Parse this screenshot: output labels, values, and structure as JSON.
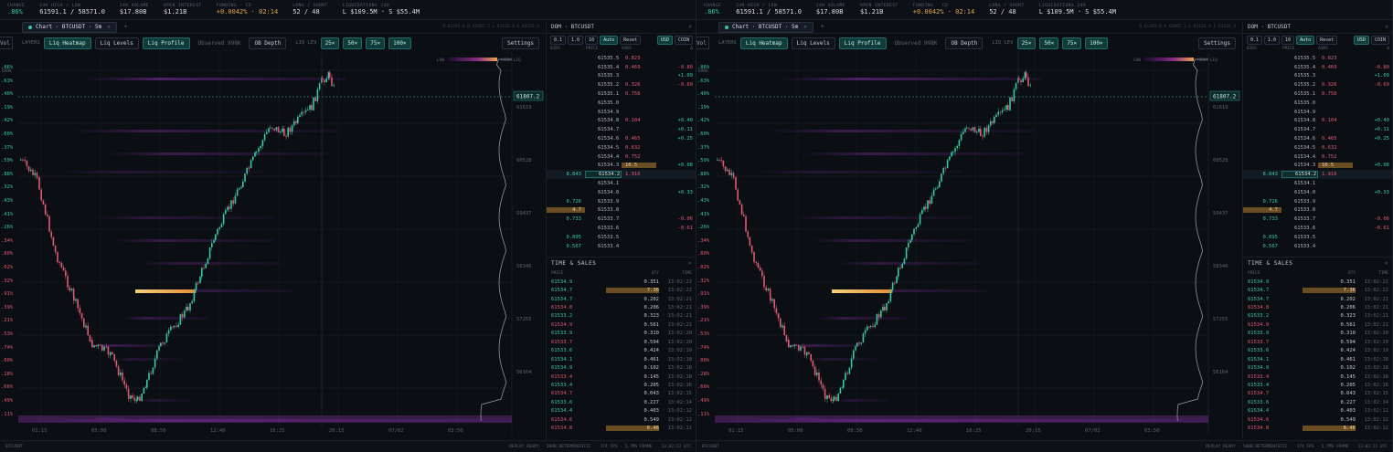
{
  "stats": [
    {
      "label": "CHANGE",
      "value": ".86%",
      "tone": "green"
    },
    {
      "label": "24H HIGH / LOW",
      "value": "61591.1 / 58571.0",
      "tone": ""
    },
    {
      "label": "24H VOLUME",
      "value": "$17.80B",
      "tone": ""
    },
    {
      "label": "OPEN INTEREST",
      "value": "$1.21B",
      "tone": ""
    },
    {
      "label": "FUNDING · CD",
      "value": "+0.0042% · 02:14",
      "tone": "amber"
    },
    {
      "label": "LONG / SHORT",
      "value": "52 / 48",
      "tone": ""
    },
    {
      "label": "LIQUIDATIONS 24H",
      "value": "L $109.5M · S $55.4M",
      "tone": ""
    }
  ],
  "tab": {
    "label": "Chart · BTCUSDT · 5m",
    "close": "×",
    "plus": "+",
    "info": "O 61395.0   H 61807.2   L 61135.4   C 61135.4"
  },
  "controls": {
    "vol": "Vol",
    "layers_label": "LAYERS",
    "liq_heatmap": "Liq Heatmap",
    "liq_levels": "Liq Levels",
    "liq_profile": "Liq Profile",
    "observed": "Observed 998K",
    "ob_depth": "OB Depth",
    "liq_lev_label": "LIQ LEV",
    "lev": [
      "25×",
      "50×",
      "75×",
      "100×"
    ],
    "settings": "Settings"
  },
  "legend": {
    "dark": "DARK",
    "low": "LOW",
    "high": "HIGH LIQ"
  },
  "price_tag": "61807.2",
  "yleft": [
    {
      "t": ".86%",
      "c": "gr"
    },
    {
      "t": ".63%",
      "c": "gr"
    },
    {
      "t": ".40%",
      "c": "gr"
    },
    {
      "t": ".19%",
      "c": "gr"
    },
    {
      "t": ".42%",
      "c": "gr"
    },
    {
      "t": ".60%",
      "c": "gr"
    },
    {
      "t": ".37%",
      "c": "gr"
    },
    {
      "t": ".59%",
      "c": "gr"
    },
    {
      "t": ".88%",
      "c": "gr"
    },
    {
      "t": ".32%",
      "c": "gr"
    },
    {
      "t": ".43%",
      "c": "gr"
    },
    {
      "t": ".41%",
      "c": "gr"
    },
    {
      "t": ".26%",
      "c": "gr"
    },
    {
      "t": ".34%",
      "c": "rd"
    },
    {
      "t": ".80%",
      "c": "rd"
    },
    {
      "t": ".02%",
      "c": "rd"
    },
    {
      "t": ".32%",
      "c": "rd"
    },
    {
      "t": ".91%",
      "c": "rd"
    },
    {
      "t": ".39%",
      "c": "rd"
    },
    {
      "t": ".21%",
      "c": "rd"
    },
    {
      "t": ".53%",
      "c": "rd"
    },
    {
      "t": ".74%",
      "c": "rd"
    },
    {
      "t": ".00%",
      "c": "rd"
    },
    {
      "t": ".28%",
      "c": "rd"
    },
    {
      "t": ".66%",
      "c": "rd"
    },
    {
      "t": ".49%",
      "c": "rd"
    },
    {
      "t": ".11%",
      "c": "rd"
    }
  ],
  "yright": [
    "61619",
    "60528",
    "59437",
    "58346",
    "57255",
    "56164"
  ],
  "xaxis": [
    "01:15",
    "05:00",
    "08:50",
    "12:40",
    "16:25",
    "20:15",
    "07/02",
    "03:50"
  ],
  "bottom": {
    "left": "BTCUSDT",
    "replay": "REPLAY READY · 500B DETERMINISTIC",
    "fps": "174 FPS · 5.7MS FRAME",
    "time": "13:02:22 UTC"
  },
  "dom": {
    "title": "DOM · BTCUSDT",
    "close": "×",
    "steps": [
      "0.1",
      "1.0",
      "10",
      "Auto",
      "Reset"
    ],
    "units": [
      "USD",
      "COIN"
    ],
    "cols": [
      "BIDS",
      "PRICE",
      "ASKS",
      "Δ"
    ],
    "rows": [
      {
        "bid": "",
        "price": "61535.5",
        "ask": "0.823",
        "d": "",
        "dc": ""
      },
      {
        "bid": "",
        "price": "61535.4",
        "ask": "0.469",
        "d": "-0.80",
        "dc": "rd"
      },
      {
        "bid": "",
        "price": "61535.3",
        "ask": "",
        "d": "+1.09",
        "dc": "gr"
      },
      {
        "bid": "",
        "price": "61535.2",
        "ask": "0.326",
        "d": "-0.69",
        "dc": "rd"
      },
      {
        "bid": "",
        "price": "61535.1",
        "ask": "0.756",
        "d": "",
        "dc": ""
      },
      {
        "bid": "",
        "price": "61535.0",
        "ask": "",
        "d": "",
        "dc": ""
      },
      {
        "bid": "",
        "price": "61534.9",
        "ask": "",
        "d": "",
        "dc": ""
      },
      {
        "bid": "",
        "price": "61534.8",
        "ask": "0.104",
        "d": "+0.40",
        "dc": "gr"
      },
      {
        "bid": "",
        "price": "61534.7",
        "ask": "",
        "d": "+0.11",
        "dc": "gr"
      },
      {
        "bid": "",
        "price": "61534.6",
        "ask": "0.465",
        "d": "+0.25",
        "dc": "gr"
      },
      {
        "bid": "",
        "price": "61534.5",
        "ask": "0.632",
        "d": "",
        "dc": ""
      },
      {
        "bid": "",
        "price": "61534.4",
        "ask": "0.752",
        "d": "",
        "dc": ""
      },
      {
        "bid": "",
        "price": "61534.3",
        "ask": "10.5",
        "d": "+0.08",
        "dc": "gr",
        "askhl": true
      },
      {
        "bid": "8.843",
        "price": "61534.2",
        "ask": "1.916",
        "d": "",
        "dc": "",
        "mid": true
      },
      {
        "bid": "",
        "price": "61534.1",
        "ask": "",
        "d": "",
        "dc": ""
      },
      {
        "bid": "",
        "price": "61534.0",
        "ask": "",
        "d": "+0.33",
        "dc": "gr"
      },
      {
        "bid": "0.726",
        "price": "61533.9",
        "ask": "",
        "d": "",
        "dc": ""
      },
      {
        "bid": "4.7",
        "price": "61533.8",
        "ask": "",
        "d": "",
        "dc": "",
        "bidhl": true
      },
      {
        "bid": "0.733",
        "price": "61533.7",
        "ask": "",
        "d": "-0.06",
        "dc": "rd"
      },
      {
        "bid": "",
        "price": "61533.6",
        "ask": "",
        "d": "-0.61",
        "dc": "rd"
      },
      {
        "bid": "0.895",
        "price": "61533.5",
        "ask": "",
        "d": "",
        "dc": ""
      },
      {
        "bid": "0.567",
        "price": "61533.4",
        "ask": "",
        "d": "",
        "dc": ""
      }
    ]
  },
  "ts": {
    "title": "TIME & SALES",
    "close": "×",
    "cols": [
      "PRICE",
      "QTY",
      "TIME"
    ],
    "rows": [
      {
        "p": "61534.9",
        "q": "0.351",
        "t": "13:02:22",
        "c": "gr"
      },
      {
        "p": "61534.7",
        "q": "7.36",
        "t": "13:02:22",
        "c": "gr",
        "big": true
      },
      {
        "p": "61534.7",
        "q": "0.202",
        "t": "13:02:21",
        "c": "gr"
      },
      {
        "p": "61534.8",
        "q": "0.206",
        "t": "13:02:21",
        "c": "rd"
      },
      {
        "p": "61533.2",
        "q": "0.323",
        "t": "13:02:21",
        "c": "gr"
      },
      {
        "p": "61534.9",
        "q": "0.561",
        "t": "13:02:21",
        "c": "rd"
      },
      {
        "p": "61533.9",
        "q": "0.310",
        "t": "13:02:20",
        "c": "gr"
      },
      {
        "p": "61533.7",
        "q": "0.594",
        "t": "13:02:20",
        "c": "rd"
      },
      {
        "p": "61533.6",
        "q": "0.424",
        "t": "13:02:19",
        "c": "gr"
      },
      {
        "p": "61534.1",
        "q": "0.461",
        "t": "13:02:18",
        "c": "gr"
      },
      {
        "p": "61534.9",
        "q": "0.102",
        "t": "13:02:18",
        "c": "gr"
      },
      {
        "p": "61533.4",
        "q": "0.145",
        "t": "13:02:18",
        "c": "rd"
      },
      {
        "p": "61533.4",
        "q": "0.205",
        "t": "13:02:16",
        "c": "gr"
      },
      {
        "p": "61534.7",
        "q": "0.043",
        "t": "13:02:15",
        "c": "rd"
      },
      {
        "p": "61533.6",
        "q": "0.227",
        "t": "13:02:14",
        "c": "gr"
      },
      {
        "p": "61534.4",
        "q": "0.403",
        "t": "13:02:12",
        "c": "gr"
      },
      {
        "p": "61534.6",
        "q": "0.549",
        "t": "13:02:12",
        "c": "rd"
      },
      {
        "p": "61534.8",
        "q": "6.46",
        "t": "13:02:12",
        "c": "rd",
        "big": true
      }
    ]
  },
  "colors": {
    "bull": "#36c9a2",
    "bear": "#e05a72",
    "accent": "#1f6b66"
  }
}
